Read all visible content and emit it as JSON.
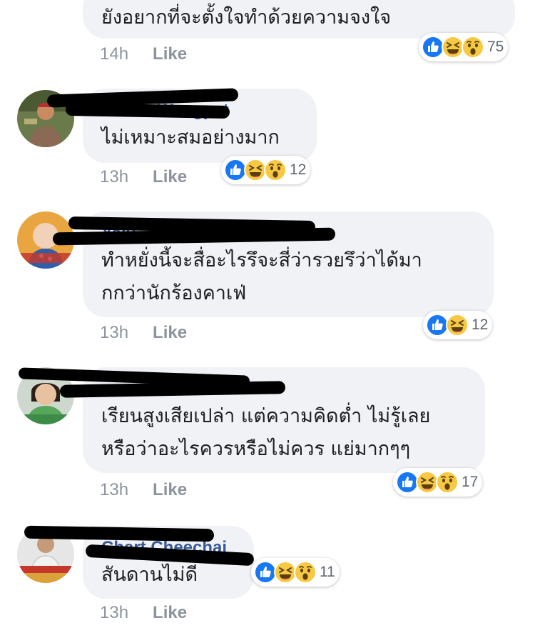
{
  "comments": [
    {
      "text_lines": [
        "ยังอยากที่จะตั้งใจทำด้วยความจงใจ"
      ],
      "time": "14h",
      "like_label": "Like",
      "reaction_count": "75",
      "reactions": [
        "like-icon",
        "haha-icon",
        "wow-icon"
      ]
    },
    {
      "name": "Tawee Wangpat",
      "text_lines": [
        "ไม่เหมาะสมอย่างมาก"
      ],
      "time": "13h",
      "like_label": "Like",
      "reaction_count": "12",
      "reactions": [
        "like-icon",
        "haha-icon",
        "wow-icon"
      ]
    },
    {
      "name": "Yaiy...",
      "text_lines": [
        "ทำหยั่งนี้จะสื่อะไรรึจะสี่ว่ารวยรึว่าได้มา",
        "กกว่านักร้องคาเฟ่"
      ],
      "time": "13h",
      "like_label": "Like",
      "reaction_count": "12",
      "reactions": [
        "like-icon",
        "haha-icon"
      ]
    },
    {
      "name": "...",
      "text_lines": [
        "เรียนสูงเสียเปล่า แต่ความคิดต่ำ ไม่รู้เลย",
        "หรือว่าอะไรควรหรือไม่ควร แย่มากๆๆ"
      ],
      "time": "13h",
      "like_label": "Like",
      "reaction_count": "17",
      "reactions": [
        "like-icon",
        "haha-icon",
        "wow-icon"
      ]
    },
    {
      "name": "Chart Cheechai",
      "text_lines": [
        "สันดานไม่ดี"
      ],
      "time": "13h",
      "like_label": "Like",
      "reaction_count": "11",
      "reactions": [
        "like-icon",
        "haha-icon",
        "wow-icon"
      ]
    }
  ],
  "colors": {
    "bubble_bg": "#f1f2f6",
    "like_blue": "#1877f2",
    "emoji_yellow": "#f7c844",
    "meta_gray": "#8d949e",
    "name_blue": "#385898"
  }
}
